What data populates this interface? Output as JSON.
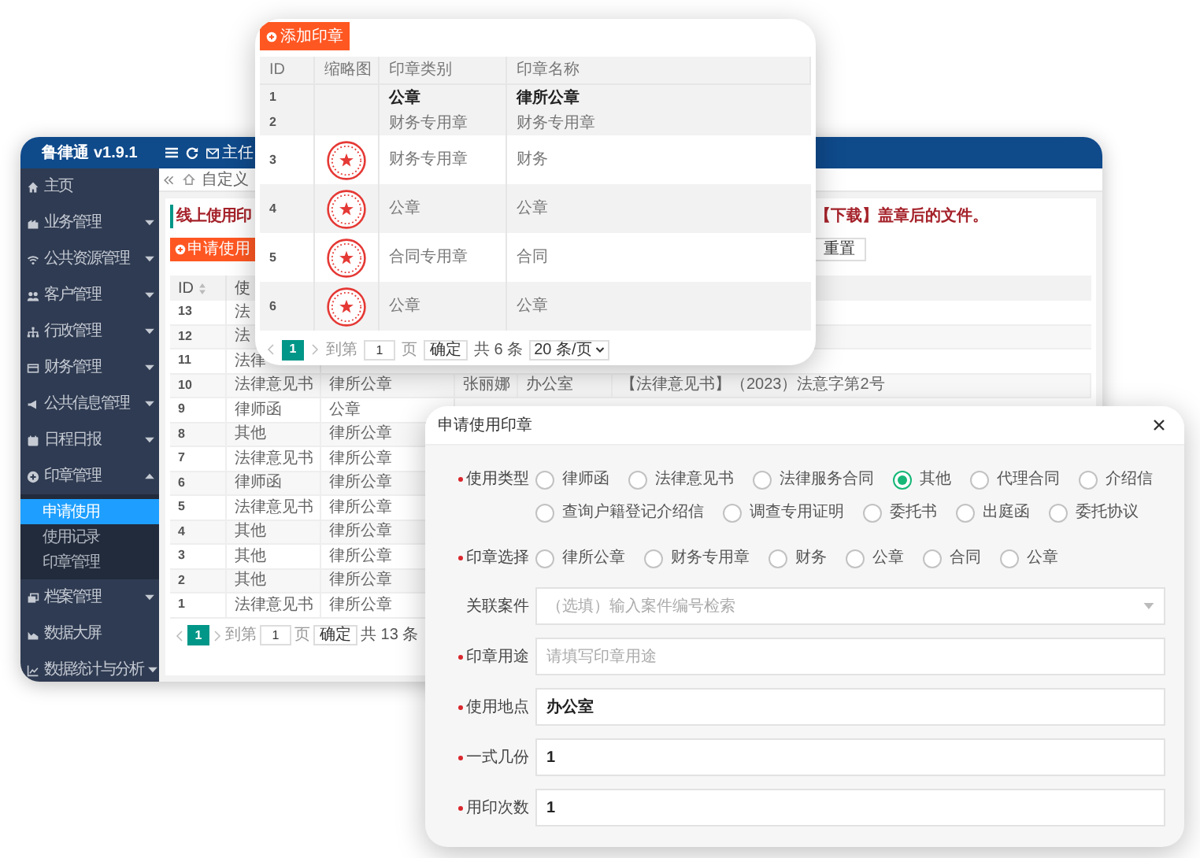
{
  "admin_window": {
    "brand": "鲁律通 v1.9.1",
    "header_user": "主任",
    "nav_tab": "自定义",
    "sidebar": [
      {
        "label": "主页",
        "kind": "link"
      },
      {
        "label": "业务管理",
        "kind": "menu",
        "expanded": false
      },
      {
        "label": "公共资源管理",
        "kind": "menu",
        "expanded": false
      },
      {
        "label": "客户管理",
        "kind": "menu",
        "expanded": false
      },
      {
        "label": "行政管理",
        "kind": "menu",
        "expanded": false
      },
      {
        "label": "财务管理",
        "kind": "menu",
        "expanded": false
      },
      {
        "label": "公共信息管理",
        "kind": "menu",
        "expanded": false
      },
      {
        "label": "日程日报",
        "kind": "menu",
        "expanded": false
      },
      {
        "label": "印章管理",
        "kind": "menu",
        "expanded": true,
        "children": [
          {
            "label": "申请使用",
            "selected": true
          },
          {
            "label": "使用记录",
            "selected": false
          },
          {
            "label": "印章管理",
            "selected": false
          }
        ]
      },
      {
        "label": "档案管理",
        "kind": "menu",
        "expanded": false
      },
      {
        "label": "数据大屏",
        "kind": "link"
      },
      {
        "label": "数据统计与分析",
        "kind": "menu",
        "expanded": false
      }
    ],
    "page_title": "线上使用印",
    "notice": "【下载】盖章后的文件。",
    "apply_button": "申请使用",
    "reset_button": "重置",
    "table": {
      "columns": [
        {
          "label": "ID",
          "sortable": true
        },
        {
          "label": "使",
          "sortable": false
        }
      ],
      "rows": [
        [
          "13",
          "法"
        ],
        [
          "12",
          "法"
        ],
        [
          "11",
          "法律"
        ],
        [
          "10",
          "法律意见书",
          "律所公章",
          "张丽娜",
          "办公室",
          "【法律意见书】（2023）法意字第2号"
        ],
        [
          "9",
          "律师函",
          "公章"
        ],
        [
          "8",
          "其他",
          "律所公章"
        ],
        [
          "7",
          "法律意见书",
          "律所公章"
        ],
        [
          "6",
          "律师函",
          "律所公章"
        ],
        [
          "5",
          "法律意见书",
          "律所公章"
        ],
        [
          "4",
          "其他",
          "律所公章"
        ],
        [
          "3",
          "其他",
          "律所公章"
        ],
        [
          "2",
          "其他",
          "律所公章"
        ],
        [
          "1",
          "法律意见书",
          "律所公章"
        ]
      ]
    },
    "pagination": {
      "current_page": "1",
      "goto_label": "到第",
      "goto_value": "1",
      "page_unit": "页",
      "confirm": "确定",
      "total": "共 13 条"
    }
  },
  "seal_window": {
    "add_button": "添加印章",
    "columns": [
      "ID",
      "缩略图",
      "印章类别",
      "印章名称"
    ],
    "rows": [
      {
        "id": "1",
        "category": "公章",
        "name": "律所公章",
        "thumbnail": false,
        "highlighted": true
      },
      {
        "id": "2",
        "category": "财务专用章",
        "name": "财务专用章",
        "thumbnail": false,
        "highlighted": false
      },
      {
        "id": "3",
        "category": "财务专用章",
        "name": "财务",
        "thumbnail": true,
        "highlighted": false
      },
      {
        "id": "4",
        "category": "公章",
        "name": "公章",
        "thumbnail": true,
        "highlighted": false
      },
      {
        "id": "5",
        "category": "合同专用章",
        "name": "合同",
        "thumbnail": true,
        "highlighted": false
      },
      {
        "id": "6",
        "category": "公章",
        "name": "公章",
        "thumbnail": true,
        "highlighted": false
      }
    ],
    "pagination": {
      "current_page": "1",
      "goto_label": "到第",
      "goto_value": "1",
      "page_unit": "页",
      "confirm": "确定",
      "total": "共 6 条",
      "page_size": "20 条/页"
    }
  },
  "apply_dialog": {
    "title": "申请使用印章",
    "fields": [
      {
        "label": "使用类型",
        "required": true,
        "kind": "radio",
        "options": [
          {
            "label": "律师函",
            "selected": false
          },
          {
            "label": "法律意见书",
            "selected": false
          },
          {
            "label": "法律服务合同",
            "selected": false
          },
          {
            "label": "其他",
            "selected": true
          },
          {
            "label": "代理合同",
            "selected": false
          },
          {
            "label": "介绍信",
            "selected": false
          },
          {
            "label": "查询户籍登记介绍信",
            "selected": false
          },
          {
            "label": "调查专用证明",
            "selected": false
          },
          {
            "label": "委托书",
            "selected": false
          },
          {
            "label": "出庭函",
            "selected": false
          },
          {
            "label": "委托协议",
            "selected": false
          }
        ]
      },
      {
        "label": "印章选择",
        "required": true,
        "kind": "radio",
        "options": [
          {
            "label": "律所公章",
            "selected": false
          },
          {
            "label": "财务专用章",
            "selected": false
          },
          {
            "label": "财务",
            "selected": false
          },
          {
            "label": "公章",
            "selected": false
          },
          {
            "label": "合同",
            "selected": false
          },
          {
            "label": "公章",
            "selected": false
          }
        ]
      },
      {
        "label": "关联案件",
        "required": false,
        "kind": "select",
        "placeholder": "（选填）输入案件编号检索"
      },
      {
        "label": "印章用途",
        "required": true,
        "kind": "text",
        "placeholder": "请填写印章用途"
      },
      {
        "label": "使用地点",
        "required": true,
        "kind": "text",
        "value": "办公室"
      },
      {
        "label": "一式几份",
        "required": true,
        "kind": "text",
        "value": "1"
      },
      {
        "label": "用印次数",
        "required": true,
        "kind": "text",
        "value": "1"
      }
    ]
  }
}
